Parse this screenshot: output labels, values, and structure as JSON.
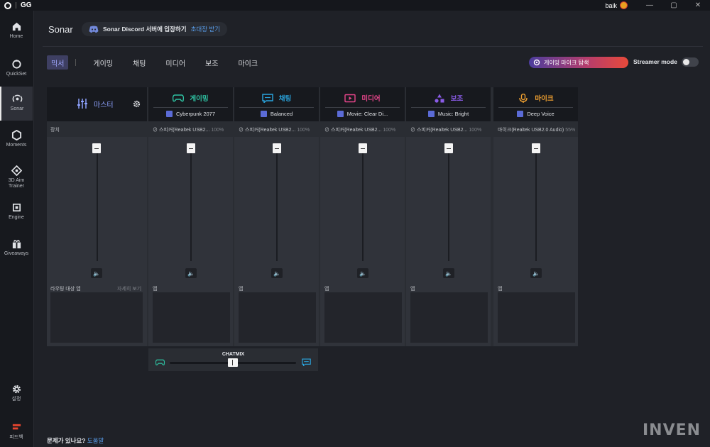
{
  "titlebar": {
    "app": "GG",
    "user": "baik",
    "minimize": "—",
    "maximize": "▢",
    "close": "✕"
  },
  "sidebar": {
    "items": [
      {
        "label": "Home",
        "icon": "home-icon"
      },
      {
        "label": "QuickSet",
        "icon": "quickset-icon"
      },
      {
        "label": "Sonar",
        "icon": "sonar-icon"
      },
      {
        "label": "Moments",
        "icon": "moments-icon"
      },
      {
        "label": "3D Aim Trainer",
        "icon": "aim-trainer-icon"
      },
      {
        "label": "Engine",
        "icon": "engine-icon"
      },
      {
        "label": "Giveaways",
        "icon": "gift-icon"
      },
      {
        "label": "설정",
        "icon": "gear-icon"
      },
      {
        "label": "피드백",
        "icon": "feedback-icon"
      }
    ]
  },
  "header": {
    "title": "Sonar",
    "discord_text": "Sonar Discord 서버에 입장하기",
    "discord_link": "초대장 받기"
  },
  "tabs": [
    "믹서",
    "게이밍",
    "채팅",
    "미디어",
    "보조",
    "마이크"
  ],
  "mic_pill": "게이밍 마이크 탐색",
  "streamer_mode": "Streamer mode",
  "streamer_on": false,
  "master": {
    "name": "마스터",
    "device_label": "장치",
    "routing_label": "라우팅 대상 앱",
    "detail_link": "자세히 보기"
  },
  "channels": [
    {
      "name": "게이밍",
      "color": "#2ec3a3",
      "preset": "Cyberpunk 2077",
      "device": "스피커(Realtek USB2...",
      "pct": "100%",
      "app_label": "앱"
    },
    {
      "name": "채팅",
      "color": "#2aa6e0",
      "preset": "Balanced",
      "device": "스피커(Realtek USB2...",
      "pct": "100%",
      "app_label": "앱"
    },
    {
      "name": "미디어",
      "color": "#e8458b",
      "preset": "Movie: Clear Di...",
      "device": "스피커(Realtek USB2...",
      "pct": "100%",
      "app_label": "앱"
    },
    {
      "name": "보조",
      "color": "#8b5ce8",
      "preset": "Music: Bright",
      "device": "스피커(Realtek USB2...",
      "pct": "100%",
      "app_label": "앱"
    },
    {
      "name": "마이크",
      "color": "#f0a030",
      "preset": "Deep Voice",
      "device": "마이크(Realtek USB2.0 Audio)",
      "pct": "55%",
      "app_label": "앱"
    }
  ],
  "chatmix": {
    "label": "CHATMIX"
  },
  "footer": {
    "question": "문제가 있나요?",
    "link": "도움말"
  },
  "watermark": "INVEN"
}
